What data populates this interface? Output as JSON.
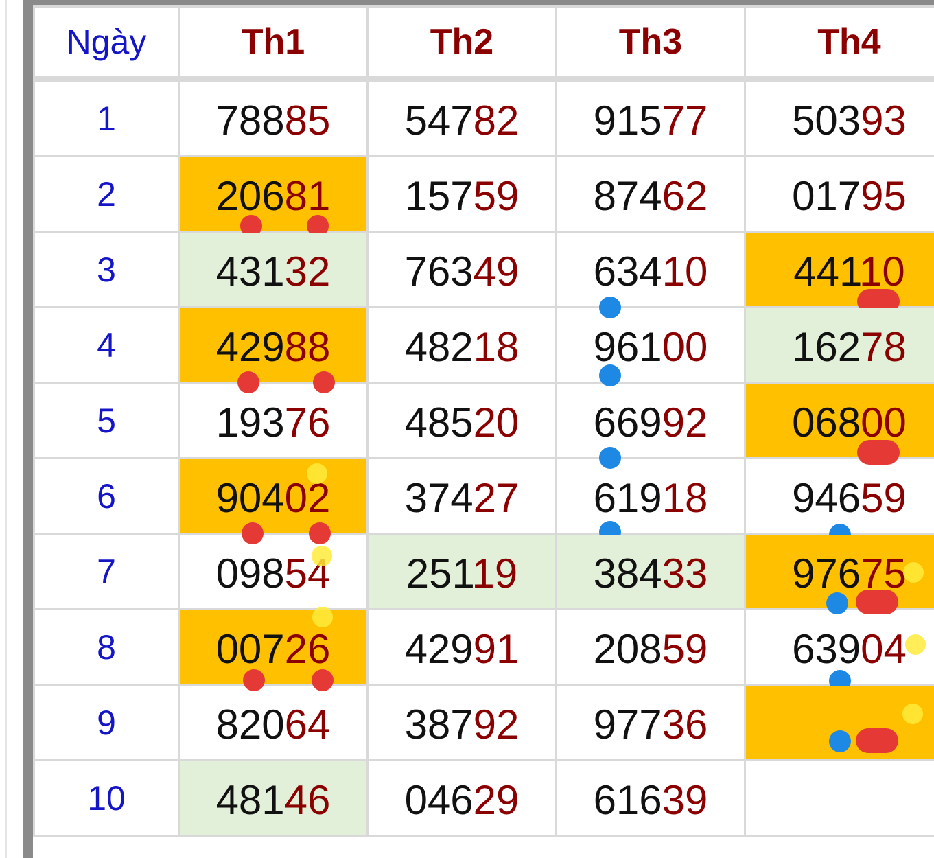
{
  "header": {
    "day": "Ngày",
    "cols": [
      "Th1",
      "Th2",
      "Th3",
      "Th4"
    ]
  },
  "rows": [
    {
      "day": "1",
      "cells": [
        {
          "head": "788",
          "tail": "85"
        },
        {
          "head": "547",
          "tail": "82"
        },
        {
          "head": "915",
          "tail": "77"
        },
        {
          "head": "503",
          "tail": "93"
        }
      ]
    },
    {
      "day": "2",
      "cells": [
        {
          "head": "206",
          "tail": "81",
          "highlight": "orange"
        },
        {
          "head": "157",
          "tail": "59"
        },
        {
          "head": "874",
          "tail": "62"
        },
        {
          "head": "017",
          "tail": "95"
        }
      ]
    },
    {
      "day": "3",
      "cells": [
        {
          "head": "431",
          "tail": "32",
          "highlight": "green"
        },
        {
          "head": "763",
          "tail": "49"
        },
        {
          "head": "634",
          "tail": "10"
        },
        {
          "head": "441",
          "tail": "10",
          "highlight": "orange"
        }
      ]
    },
    {
      "day": "4",
      "cells": [
        {
          "head": "429",
          "tail": "88",
          "highlight": "orange"
        },
        {
          "head": "482",
          "tail": "18"
        },
        {
          "head": "961",
          "tail": "00"
        },
        {
          "head": "162",
          "tail": "78",
          "highlight": "green"
        }
      ]
    },
    {
      "day": "5",
      "cells": [
        {
          "head": "193",
          "tail": "76"
        },
        {
          "head": "485",
          "tail": "20"
        },
        {
          "head": "669",
          "tail": "92"
        },
        {
          "head": "068",
          "tail": "00",
          "highlight": "orange"
        }
      ]
    },
    {
      "day": "6",
      "cells": [
        {
          "head": "904",
          "tail": "02",
          "highlight": "orange"
        },
        {
          "head": "374",
          "tail": "27"
        },
        {
          "head": "619",
          "tail": "18"
        },
        {
          "head": "946",
          "tail": "59"
        }
      ]
    },
    {
      "day": "7",
      "cells": [
        {
          "head": "098",
          "tail": "54"
        },
        {
          "head": "251",
          "tail": "19",
          "highlight": "green"
        },
        {
          "head": "384",
          "tail": "33",
          "highlight": "green"
        },
        {
          "head": "976",
          "tail": "75",
          "highlight": "orange"
        }
      ]
    },
    {
      "day": "8",
      "cells": [
        {
          "head": "007",
          "tail": "26",
          "highlight": "orange"
        },
        {
          "head": "429",
          "tail": "91"
        },
        {
          "head": "208",
          "tail": "59"
        },
        {
          "head": "639",
          "tail": "04"
        }
      ]
    },
    {
      "day": "9",
      "cells": [
        {
          "head": "820",
          "tail": "64"
        },
        {
          "head": "387",
          "tail": "92"
        },
        {
          "head": "977",
          "tail": "36"
        },
        {
          "head": "",
          "tail": "",
          "highlight": "orange"
        }
      ]
    },
    {
      "day": "10",
      "cells": [
        {
          "head": "481",
          "tail": "46",
          "highlight": "green"
        },
        {
          "head": "046",
          "tail": "29"
        },
        {
          "head": "616",
          "tail": "39"
        },
        {
          "head": "",
          "tail": ""
        }
      ]
    }
  ],
  "colors": {
    "orange_highlight": "#ffc000",
    "green_highlight": "#e2f0d9",
    "header_text": "#8b0000",
    "day_text": "#1515c8",
    "tail_digits": "#8b0000",
    "annotation_red": "#e53935",
    "annotation_blue": "#1e88e5",
    "annotation_yellow": "#ffeb3b"
  },
  "annotations": [
    {
      "row": 2,
      "col": 1,
      "kind": "dot-red"
    },
    {
      "row": 2,
      "col": 1,
      "kind": "dot-red"
    },
    {
      "row": 3,
      "col": 3,
      "kind": "dot-blue"
    },
    {
      "row": 3,
      "col": 4,
      "kind": "bar-red"
    },
    {
      "row": 4,
      "col": 1,
      "kind": "dot-red"
    },
    {
      "row": 4,
      "col": 1,
      "kind": "dot-red"
    },
    {
      "row": 4,
      "col": 3,
      "kind": "dot-blue"
    },
    {
      "row": 5,
      "col": 3,
      "kind": "dot-blue"
    },
    {
      "row": 5,
      "col": 4,
      "kind": "bar-red"
    },
    {
      "row": 6,
      "col": 1,
      "kind": "dot-yellow"
    },
    {
      "row": 6,
      "col": 1,
      "kind": "dot-red"
    },
    {
      "row": 6,
      "col": 1,
      "kind": "dot-red"
    },
    {
      "row": 6,
      "col": 3,
      "kind": "dot-blue"
    },
    {
      "row": 6,
      "col": 4,
      "kind": "dot-blue"
    },
    {
      "row": 7,
      "col": 1,
      "kind": "dot-yellow"
    },
    {
      "row": 7,
      "col": 4,
      "kind": "dot-yellow"
    },
    {
      "row": 7,
      "col": 4,
      "kind": "dot-blue"
    },
    {
      "row": 7,
      "col": 4,
      "kind": "bar-red"
    },
    {
      "row": 8,
      "col": 1,
      "kind": "dot-yellow"
    },
    {
      "row": 8,
      "col": 1,
      "kind": "dot-red"
    },
    {
      "row": 8,
      "col": 1,
      "kind": "dot-red"
    },
    {
      "row": 8,
      "col": 4,
      "kind": "dot-yellow"
    },
    {
      "row": 8,
      "col": 4,
      "kind": "dot-blue"
    },
    {
      "row": 9,
      "col": 4,
      "kind": "dot-yellow"
    },
    {
      "row": 9,
      "col": 4,
      "kind": "dot-blue"
    },
    {
      "row": 9,
      "col": 4,
      "kind": "bar-red"
    }
  ]
}
